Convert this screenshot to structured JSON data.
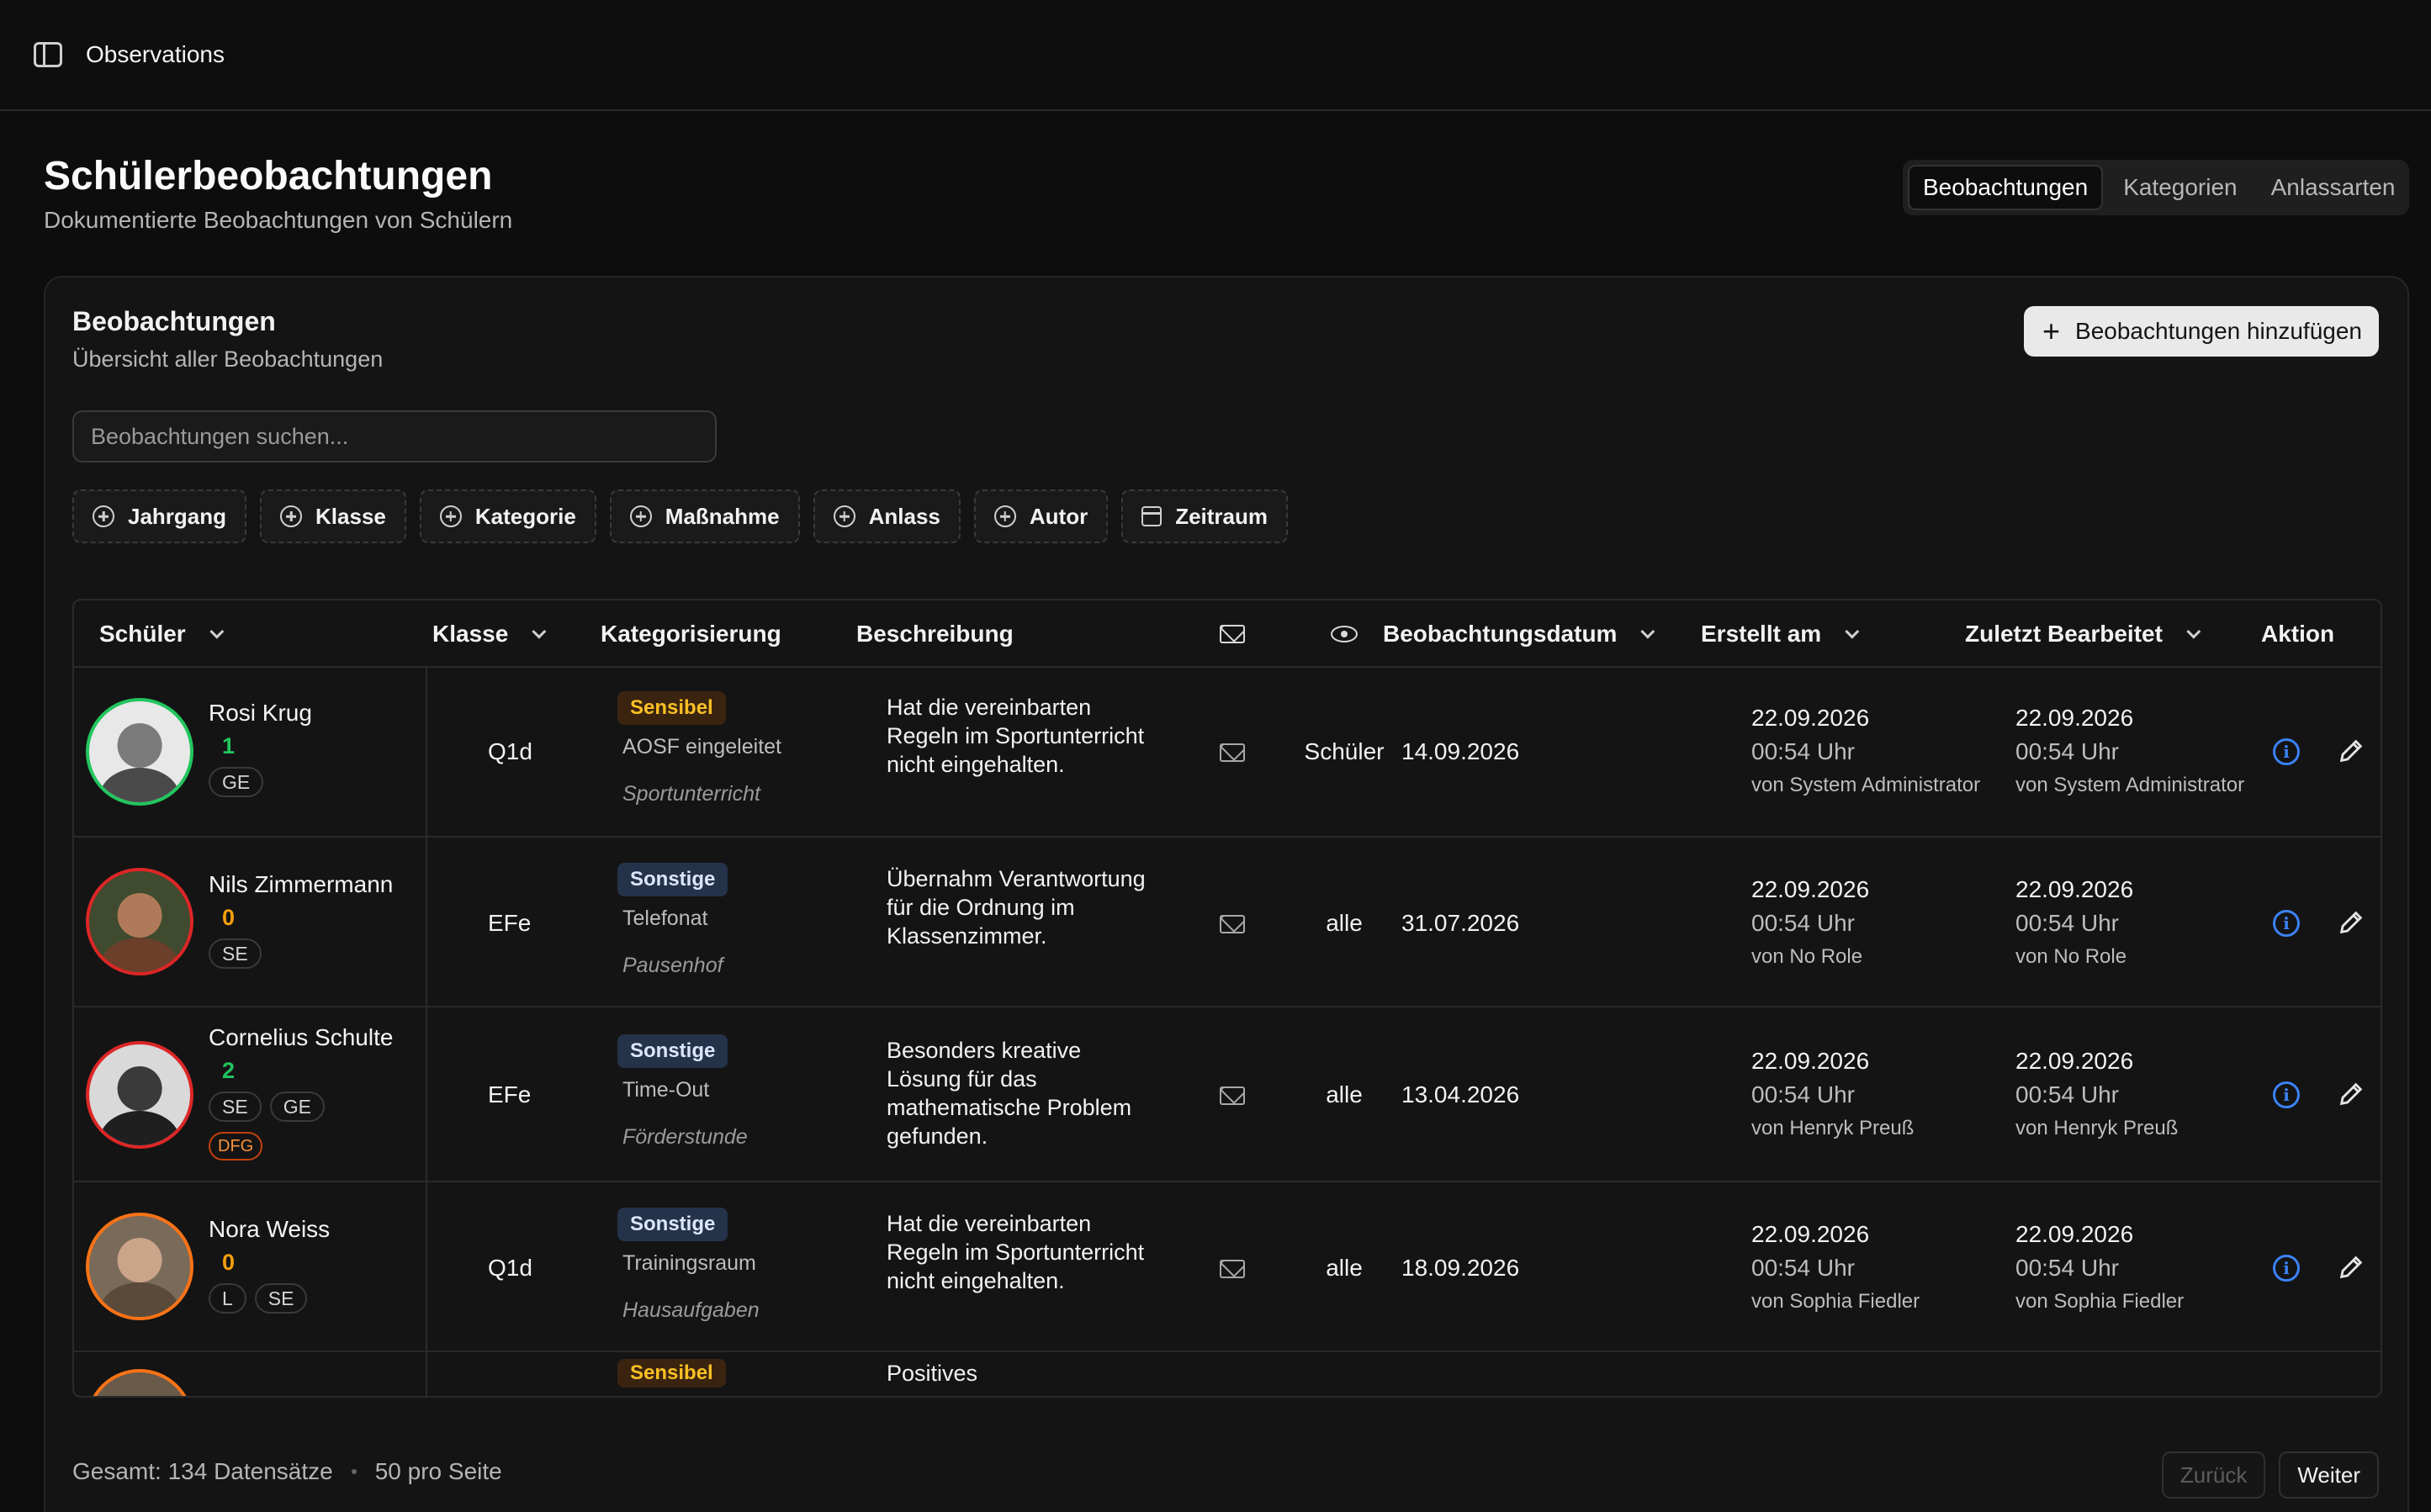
{
  "topbar": {
    "title": "Observations"
  },
  "header": {
    "title": "Schülerbeobachtungen",
    "subtitle": "Dokumentierte Beobachtungen von Schülern"
  },
  "tabs": [
    {
      "label": "Beobachtungen",
      "active": true
    },
    {
      "label": "Kategorien",
      "active": false
    },
    {
      "label": "Anlassarten",
      "active": false
    }
  ],
  "card": {
    "title": "Beobachtungen",
    "subtitle": "Übersicht aller Beobachtungen",
    "add_label": "Beobachtungen hinzufügen",
    "search_placeholder": "Beobachtungen suchen..."
  },
  "filters": [
    "Jahrgang",
    "Klasse",
    "Kategorie",
    "Maßnahme",
    "Anlass",
    "Autor",
    "Zeitraum"
  ],
  "columns": {
    "schueler": "Schüler",
    "klasse": "Klasse",
    "kategorisierung": "Kategorisierung",
    "beschreibung": "Beschreibung",
    "beobachtungsdatum": "Beobachtungsdatum",
    "erstellt": "Erstellt am",
    "bearbeitet": "Zuletzt Bearbeitet",
    "aktion": "Aktion"
  },
  "rows": [
    {
      "name": "Rosi Krug",
      "count": "1",
      "tags": [
        "GE"
      ],
      "extra_tag": "",
      "klasse": "Q1d",
      "badge": "Sensibel",
      "massnahme": "AOSF eingeleitet",
      "anlass": "Sportunterricht",
      "description": "Hat die vereinbarten Regeln im Sportunterricht nicht eingehalten.",
      "visibility": "Schüler",
      "date": "14.09.2026",
      "created_date": "22.09.2026",
      "created_time": "00:54 Uhr",
      "created_by": "von System Administrator",
      "edited_date": "22.09.2026",
      "edited_time": "00:54 Uhr",
      "edited_by": "von System Administrator"
    },
    {
      "name": "Nils Zimmermann",
      "count": "0",
      "tags": [
        "SE"
      ],
      "extra_tag": "",
      "klasse": "EFe",
      "badge": "Sonstige",
      "massnahme": "Telefonat",
      "anlass": "Pausenhof",
      "description": "Übernahm Verantwortung für die Ordnung im Klassenzimmer.",
      "visibility": "alle",
      "date": "31.07.2026",
      "created_date": "22.09.2026",
      "created_time": "00:54 Uhr",
      "created_by": "von No Role",
      "edited_date": "22.09.2026",
      "edited_time": "00:54 Uhr",
      "edited_by": "von No Role"
    },
    {
      "name": "Cornelius Schulte",
      "count": "2",
      "tags": [
        "SE",
        "GE"
      ],
      "extra_tag": "DFG",
      "klasse": "EFe",
      "badge": "Sonstige",
      "massnahme": "Time-Out",
      "anlass": "Förderstunde",
      "description": "Besonders kreative Lösung für das mathematische Problem gefunden.",
      "visibility": "alle",
      "date": "13.04.2026",
      "created_date": "22.09.2026",
      "created_time": "00:54 Uhr",
      "created_by": "von Henryk Preuß",
      "edited_date": "22.09.2026",
      "edited_time": "00:54 Uhr",
      "edited_by": "von Henryk Preuß"
    },
    {
      "name": "Nora Weiss",
      "count": "0",
      "tags": [
        "L",
        "SE"
      ],
      "extra_tag": "",
      "klasse": "Q1d",
      "badge": "Sonstige",
      "massnahme": "Trainingsraum",
      "anlass": "Hausaufgaben",
      "description": "Hat die vereinbarten Regeln im Sportunterricht nicht eingehalten.",
      "visibility": "alle",
      "date": "18.09.2026",
      "created_date": "22.09.2026",
      "created_time": "00:54 Uhr",
      "created_by": "von Sophia Fiedler",
      "edited_date": "22.09.2026",
      "edited_time": "00:54 Uhr",
      "edited_by": "von Sophia Fiedler"
    }
  ],
  "partial_row": {
    "badge": "Sensibel",
    "description": "Positives"
  },
  "footer": {
    "total": "Gesamt: 134 Datensätze",
    "per_page": "50 pro Seite",
    "prev": "Zurück",
    "next": "Weiter"
  },
  "colors": {
    "ring_green": "#22c55e",
    "ring_red": "#dc2626",
    "ring_orange": "#f97316",
    "count_green": "#22c55e",
    "count_orange": "#f59e0b",
    "info_blue": "#3b82f6"
  }
}
